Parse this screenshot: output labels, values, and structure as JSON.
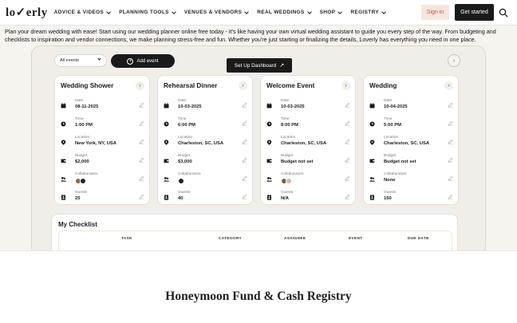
{
  "nav": {
    "logo": "lo✓erly",
    "menu": [
      {
        "label": "ADVICE & VIDEOS"
      },
      {
        "label": "PLANNING TOOLS"
      },
      {
        "label": "VENUES & VENDORS"
      },
      {
        "label": "REAL WEDDINGS"
      },
      {
        "label": "SHOP"
      },
      {
        "label": "REGISTRY"
      }
    ],
    "signin": "Sign in",
    "get_started": "Get started",
    "search_icon": "search-icon"
  },
  "intro": "Plan your dream wedding with ease! Start using our wedding planner online free today - it's like having your own virtual wedding assistant to guide you every step of the way. From budgeting and checklists to inspiration and vendor connections, we make planning stress-free and fun. Whether you're just starting or finalizing the details, Loverly has everything you need in one place.",
  "dashboard": {
    "events_select": "All events",
    "add_event": "Add event",
    "setup_button": "Set Up Dashboard",
    "labels": {
      "date": "Date",
      "time": "Time",
      "location": "Location",
      "budget": "Budget",
      "collaborators": "Collaborators",
      "guests": "Guests"
    },
    "events": [
      {
        "title": "Wedding Shower",
        "date": "08-11-2025",
        "time": "1:00 PM",
        "location": "New York, NY, USA",
        "budget": "$2,000",
        "collaborators": "",
        "guests": "25"
      },
      {
        "title": "Rehearsal Dinner",
        "date": "10-03-2025",
        "time": "6:00 PM",
        "location": "Charleston, SC, USA",
        "budget": "$3,000",
        "collaborators": "",
        "guests": "40"
      },
      {
        "title": "Welcome Event",
        "date": "10-03-2025",
        "time": "8:00 PM",
        "location": "Charleston, SC, USA",
        "budget": "Budget not set",
        "collaborators": "",
        "guests": "N/A"
      },
      {
        "title": "Wedding",
        "date": "10-04-2025",
        "time": "5:00 PM",
        "location": "Charleston, SC, USA",
        "budget": "Budget not set",
        "collaborators": "None",
        "guests": "150"
      }
    ],
    "checklist": {
      "title": "My Checklist",
      "columns": [
        "TASK",
        "CATEGORY",
        "ASSIGNEE",
        "EVENT",
        "DUE DATE"
      ]
    }
  },
  "bottom": {
    "heading": "Honeymoon Fund & Cash Registry"
  },
  "colors": {
    "dark": "#1a1a1a",
    "signin_bg": "#f7e5df",
    "signin_text": "#c25a47",
    "page_bg": "#f7f3ee"
  }
}
